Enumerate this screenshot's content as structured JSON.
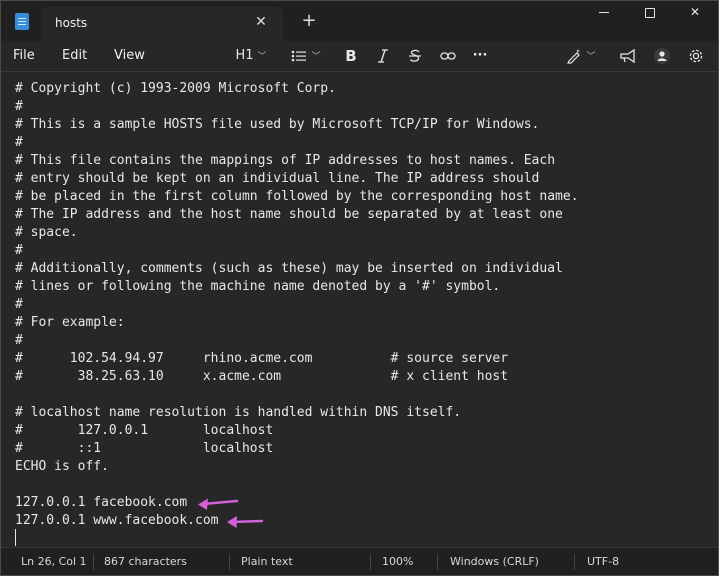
{
  "tab": {
    "title": "hosts",
    "close": "✕",
    "new_tab": "+"
  },
  "window_controls": {
    "close": "✕"
  },
  "menu": {
    "file": "File",
    "edit": "Edit",
    "view": "View"
  },
  "toolbar": {
    "heading": "H1",
    "bold": "B",
    "dots": "···"
  },
  "editor": {
    "lines": [
      "# Copyright (c) 1993-2009 Microsoft Corp.",
      "#",
      "# This is a sample HOSTS file used by Microsoft TCP/IP for Windows.",
      "#",
      "# This file contains the mappings of IP addresses to host names. Each",
      "# entry should be kept on an individual line. The IP address should",
      "# be placed in the first column followed by the corresponding host name.",
      "# The IP address and the host name should be separated by at least one",
      "# space.",
      "#",
      "# Additionally, comments (such as these) may be inserted on individual",
      "# lines or following the machine name denoted by a '#' symbol.",
      "#",
      "# For example:",
      "#",
      "#      102.54.94.97     rhino.acme.com          # source server",
      "#       38.25.63.10     x.acme.com              # x client host",
      "",
      "# localhost name resolution is handled within DNS itself.",
      "#       127.0.0.1       localhost",
      "#       ::1             localhost",
      "ECHO is off.",
      "",
      "127.0.0.1 facebook.com",
      "127.0.0.1 www.facebook.com"
    ]
  },
  "annotation": {
    "arrow_color": "#d35fd9"
  },
  "status": {
    "position": "Ln 26, Col 1",
    "characters": "867 characters",
    "format": "Plain text",
    "zoom": "100%",
    "line_ending": "Windows (CRLF)",
    "encoding": "UTF-8"
  }
}
